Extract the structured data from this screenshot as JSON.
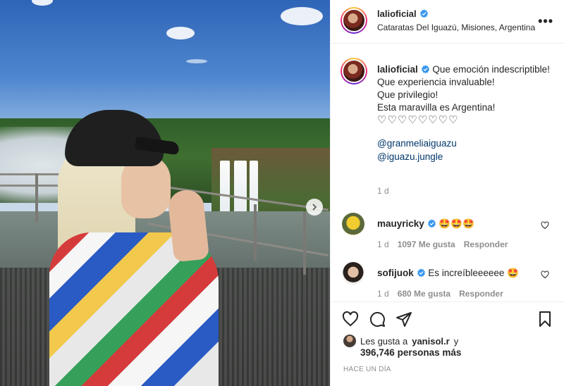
{
  "post": {
    "username": "lalioficial",
    "location": "Cataratas Del Iguazú, Misiones, Argentina",
    "more_label": "•••"
  },
  "caption": {
    "username": "lalioficial",
    "lines": [
      "Que emoción indescriptible!",
      "Que experiencia invaluable!",
      "Que privilegio!",
      "Esta maravilla es Argentina!"
    ],
    "hearts": "♡♡♡♡♡♡♡♡",
    "mentions": [
      "@granmeliaiguazu",
      "@iguazu.jungle"
    ],
    "time": "1 d"
  },
  "comments": [
    {
      "username": "mauyricky",
      "text": "🤩🤩🤩",
      "time": "1 d",
      "likes": "1097 Me gusta",
      "reply": "Responder"
    },
    {
      "username": "sofijuok",
      "text": "Es increíbleeeeee 🤩",
      "time": "1 d",
      "likes": "680 Me gusta",
      "reply": "Responder"
    }
  ],
  "engagement": {
    "liked_by_prefix": "Les gusta a",
    "liked_by_user": "yanisol.r",
    "liked_by_suffix": "y",
    "others_count": "396,746",
    "others_label": "personas más",
    "posted_ago": "HACE UN DÍA"
  },
  "icons": {
    "verified": "verified-badge-icon",
    "like": "heart-icon",
    "comment": "comment-icon",
    "share": "paper-plane-icon",
    "save": "bookmark-icon",
    "next": "chevron-right-icon"
  },
  "colors": {
    "verified": "#3897f0",
    "mention": "#00376b",
    "muted": "#8e8e8e"
  }
}
